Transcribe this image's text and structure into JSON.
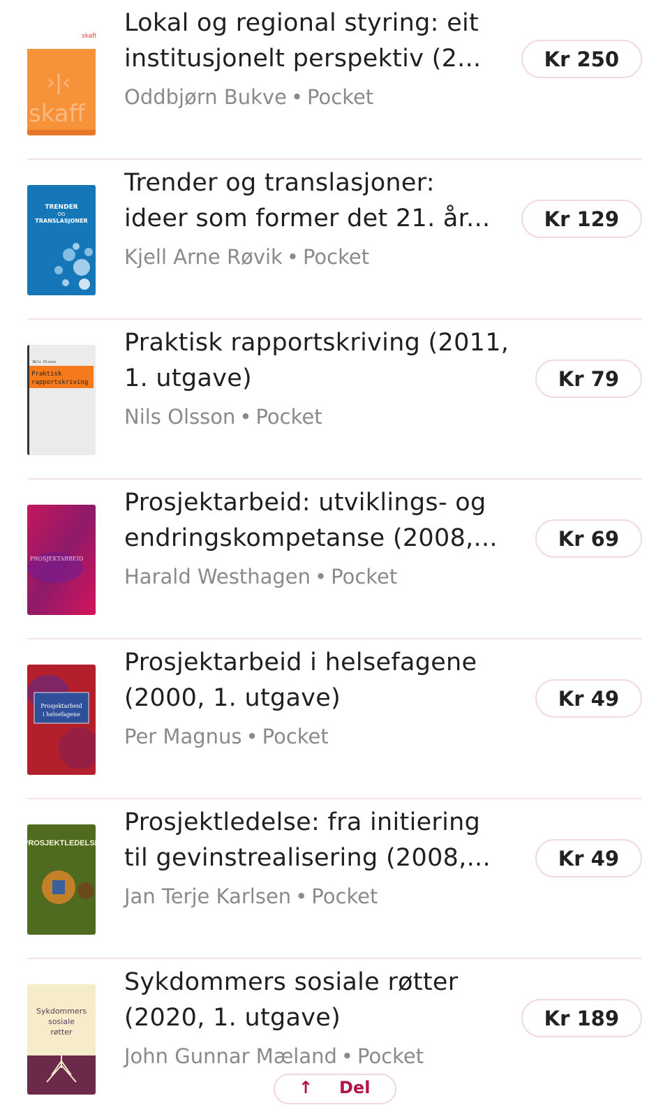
{
  "books": [
    {
      "title_line1": "Lokal og regional styring: eit",
      "title_line2": "institusjonelt perspektiv (2...",
      "author": "Oddbjørn Bukve",
      "format": "Pocket",
      "price": "Kr 250",
      "cover_icon": "book-cover-skaff",
      "cover_text": "skaff"
    },
    {
      "title_line1": "Trender og translasjoner:",
      "title_line2": "ideer som former det 21. år...",
      "author": "Kjell Arne Røvik",
      "format": "Pocket",
      "price": "Kr 129",
      "cover_icon": "book-cover-trender",
      "cover_text": "TRENDER OG TRANSLASJONER"
    },
    {
      "title_line1": "Praktisk rapportskriving (2011,",
      "title_line2": "1. utgave)",
      "author": "Nils Olsson",
      "format": "Pocket",
      "price": "Kr 79",
      "cover_icon": "book-cover-rapportskriving",
      "cover_text": "Praktisk rapportskriving"
    },
    {
      "title_line1": "Prosjektarbeid: utviklings- og",
      "title_line2": "endringskompetanse (2008,...",
      "author": "Harald Westhagen",
      "format": "Pocket",
      "price": "Kr 69",
      "cover_icon": "book-cover-prosjektarbeid",
      "cover_text": "PROSJEKTARBEID"
    },
    {
      "title_line1": "Prosjektarbeid i helsefagene",
      "title_line2": "(2000, 1. utgave)",
      "author": "Per Magnus",
      "format": "Pocket",
      "price": "Kr 49",
      "cover_icon": "book-cover-helsefagene",
      "cover_text": "Prosjektarbeid i helsefagene"
    },
    {
      "title_line1": "Prosjektledelse: fra initiering",
      "title_line2": "til gevinstrealisering (2008,...",
      "author": "Jan Terje Karlsen",
      "format": "Pocket",
      "price": "Kr 49",
      "cover_icon": "book-cover-prosjektledelse",
      "cover_text": "PROSJEKTLEDELSE"
    },
    {
      "title_line1": "Sykdommers sosiale røtter",
      "title_line2": "(2020, 1. utgave)",
      "author": "John Gunnar Mæland",
      "format": "Pocket",
      "price": "Kr 189",
      "cover_icon": "book-cover-sykdommers",
      "cover_text": "Sykdommers sosiale røtter"
    }
  ],
  "separator": "•",
  "bottom_button": {
    "icon": "upload-arrow-icon",
    "label": "Del"
  },
  "colors": {
    "accent": "#b0124a",
    "price_border": "#f2d9e1",
    "divider": "#f2e3ea",
    "meta_text": "#8a8a8a"
  }
}
